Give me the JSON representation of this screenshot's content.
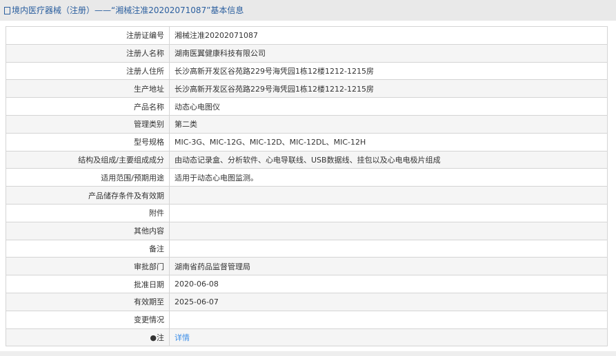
{
  "header": {
    "title": "境内医疗器械（注册）——“湘械注准20202071087”基本信息"
  },
  "rows": [
    {
      "label": "注册证编号",
      "value": "湘械注准20202071087"
    },
    {
      "label": "注册人名称",
      "value": "湖南医翼健康科技有限公司"
    },
    {
      "label": "注册人住所",
      "value": "长沙高新开发区谷苑路229号海凭园1栋12楼1212-1215房"
    },
    {
      "label": "生产地址",
      "value": "长沙高新开发区谷苑路229号海凭园1栋12楼1212-1215房"
    },
    {
      "label": "产品名称",
      "value": "动态心电图仪"
    },
    {
      "label": "管理类别",
      "value": "第二类"
    },
    {
      "label": "型号规格",
      "value": "MIC-3G、MIC-12G、MIC-12D、MIC-12DL、MIC-12H"
    },
    {
      "label": "结构及组成/主要组成成分",
      "value": "由动态记录盒、分析软件、心电导联线、USB数据线、挂包以及心电电极片组成"
    },
    {
      "label": "适用范围/预期用途",
      "value": "适用于动态心电图监测。"
    },
    {
      "label": "产品储存条件及有效期",
      "value": ""
    },
    {
      "label": "附件",
      "value": ""
    },
    {
      "label": "其他内容",
      "value": ""
    },
    {
      "label": "备注",
      "value": ""
    },
    {
      "label": "审批部门",
      "value": "湖南省药品监督管理局"
    },
    {
      "label": "批准日期",
      "value": "2020-06-08"
    },
    {
      "label": "有效期至",
      "value": "2025-06-07"
    },
    {
      "label": "变更情况",
      "value": ""
    }
  ],
  "note": {
    "label": "注",
    "link": "详情"
  }
}
